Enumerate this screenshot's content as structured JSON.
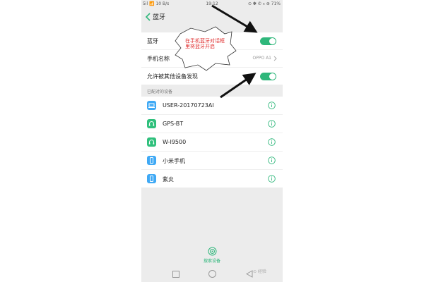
{
  "status_bar": {
    "signal_left": "5il 📶",
    "network_speed": "10 B/s",
    "time": "19:12",
    "icons": "⊙ ✽ ✆ ⁎ ⊛",
    "battery": "71%"
  },
  "header": {
    "back_icon": "chevron-left-icon",
    "title": "蓝牙"
  },
  "settings": {
    "bluetooth_label": "蓝牙",
    "bluetooth_on": true,
    "device_name_label": "手机名称",
    "device_name_value": "OPPO A1",
    "discoverable_label": "允许被其他设备发现",
    "discoverable_on": true
  },
  "paired_section": {
    "label": "已配对的设备",
    "devices": [
      {
        "name": "USER-20170723AI",
        "icon": "laptop-icon",
        "color": "#3fa9f5"
      },
      {
        "name": "GPS-BT",
        "icon": "headset-icon",
        "color": "#2fc07c"
      },
      {
        "name": "W-I9500",
        "icon": "headset-icon",
        "color": "#2fc07c"
      },
      {
        "name": "小米手机",
        "icon": "phone-icon",
        "color": "#3fa9f5"
      },
      {
        "name": "紫炎",
        "icon": "phone-icon",
        "color": "#3fa9f5"
      }
    ]
  },
  "bottom": {
    "search_label": "搜索设备"
  },
  "annotation": {
    "callout_text": "在手机蓝牙对话框里将蓝牙开启"
  },
  "watermark": "⊙ 经验",
  "colors": {
    "accent": "#2fb77b",
    "device_blue": "#3fa9f5",
    "annotation_red": "#e03030"
  }
}
